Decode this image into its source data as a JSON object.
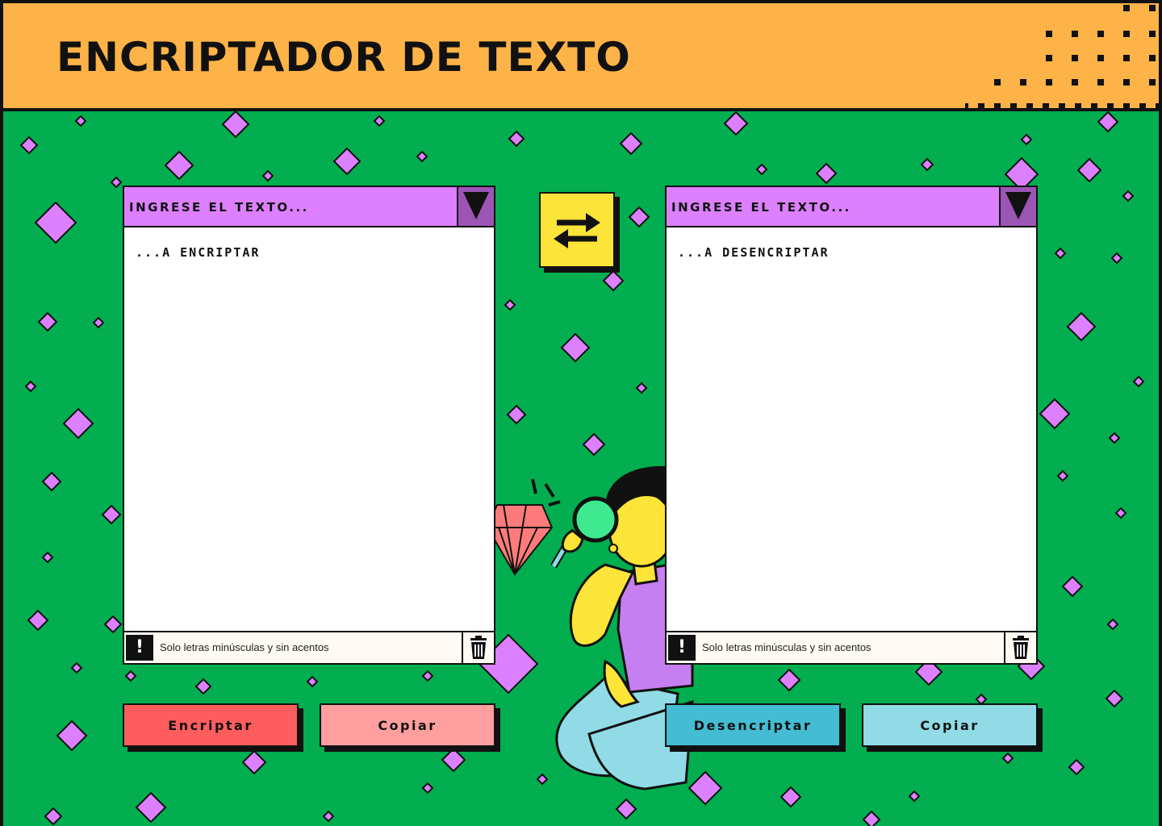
{
  "header": {
    "title": "ENCRIPTADOR DE TEXTO"
  },
  "encrypt_panel": {
    "title": "INGRESE EL TEXTO...",
    "placeholder": "...A ENCRIPTAR",
    "hint": "Solo letras minúsculas y sin acentos",
    "warn_glyph": "!"
  },
  "decrypt_panel": {
    "title": "INGRESE EL TEXTO...",
    "placeholder": "...A DESENCRIPTAR",
    "hint": "Solo letras minúsculas y sin acentos",
    "warn_glyph": "!"
  },
  "buttons": {
    "encrypt": "Encriptar",
    "copy_left": "Copiar",
    "decrypt": "Desencriptar",
    "copy_right": "Copiar"
  },
  "colors": {
    "background": "#02ae4f",
    "header": "#fdb347",
    "panel_title": "#dc80ff",
    "dropdown": "#9d55b5",
    "swap_button": "#fde438",
    "encrypt_button": "#fe5d5d",
    "copy_left_button": "#fe9e9e",
    "decrypt_button": "#44bcd3",
    "copy_right_button": "#90dbe6",
    "diamond": "#dc80ff"
  },
  "icons": {
    "swap": "swap-arrows-icon",
    "dropdown": "triangle-down-icon",
    "warning": "exclamation-icon",
    "delete": "trash-icon"
  }
}
